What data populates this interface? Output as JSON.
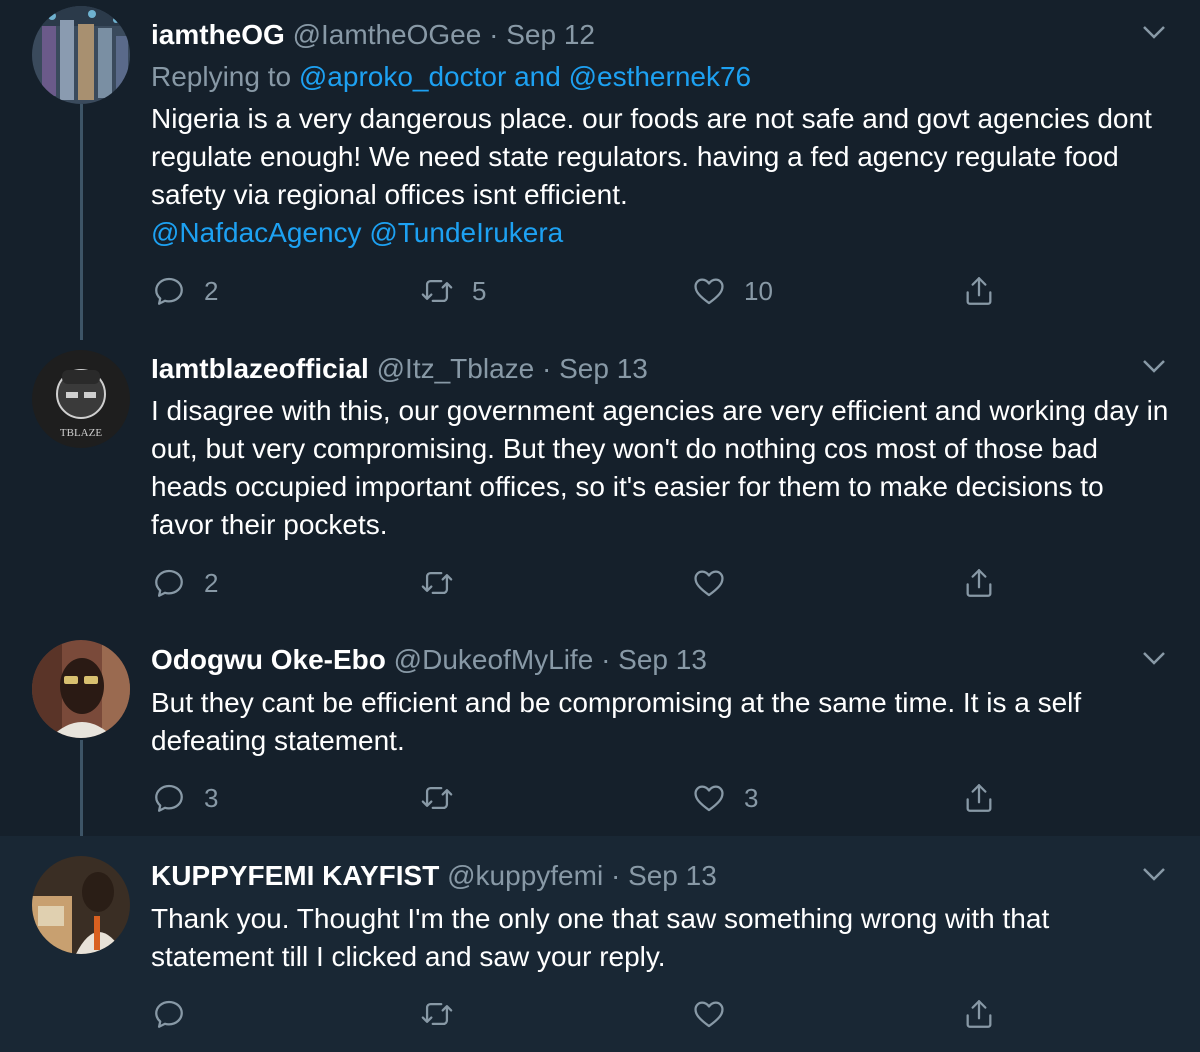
{
  "tweets": [
    {
      "display_name": "iamtheOG",
      "handle": "@IamtheOGee",
      "separator": "·",
      "date": "Sep 12",
      "replying_prefix": "Replying to",
      "replying_to": "@aproko_doctor and @esthernek76",
      "text": "Nigeria is a very dangerous place. our foods are not safe and govt agencies dont regulate enough! We need state regulators. having a fed agency regulate food safety via regional offices isnt efficient.",
      "mentions": "@NafdacAgency @TundeIrukera",
      "replies": "2",
      "retweets": "5",
      "likes": "10"
    },
    {
      "display_name": "Iamtblazeofficial",
      "handle": "@Itz_Tblaze",
      "separator": "·",
      "date": "Sep 13",
      "text": "I disagree with this, our government agencies are very efficient and working day in out, but very compromising. But they won't do nothing cos most of those bad heads occupied important offices, so it's easier for them to make decisions to favor their pockets.",
      "avatar_caption": "TBLAZE",
      "replies": "2",
      "retweets": "",
      "likes": ""
    },
    {
      "display_name": "Odogwu Oke-Ebo",
      "handle": "@DukeofMyLife",
      "separator": "·",
      "date": "Sep 13",
      "text": "But they cant be efficient and be compromising at the same time. It is a self defeating statement.",
      "replies": "3",
      "retweets": "",
      "likes": "3"
    },
    {
      "display_name": "KUPPYFEMI KAYFIST",
      "handle": "@kuppyfemi",
      "separator": "·",
      "date": "Sep 13",
      "text": "Thank you. Thought I'm the only one that saw something wrong with that statement till I clicked and saw your reply.",
      "replies": "",
      "retweets": "",
      "likes": ""
    }
  ],
  "icons": {
    "reply": "reply-icon",
    "retweet": "retweet-icon",
    "like": "heart-icon",
    "share": "share-icon",
    "more": "chevron-down-icon"
  },
  "colors": {
    "background": "#15202b",
    "highlight_background": "#192734",
    "link": "#1da1f2",
    "secondary_text": "#8899a6",
    "thread_line": "#3d5466"
  }
}
